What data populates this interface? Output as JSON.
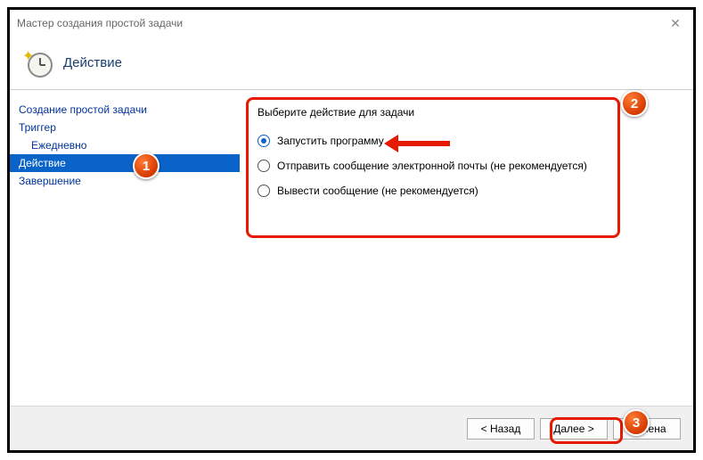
{
  "window": {
    "title": "Мастер создания простой задачи"
  },
  "header": {
    "title": "Действие"
  },
  "sidebar": {
    "items": [
      {
        "label": "Создание простой задачи"
      },
      {
        "label": "Триггер"
      },
      {
        "label": "Ежедневно"
      },
      {
        "label": "Действие"
      },
      {
        "label": "Завершение"
      }
    ]
  },
  "content": {
    "prompt": "Выберите действие для задачи",
    "options": [
      {
        "label": "Запустить программу",
        "checked": true
      },
      {
        "label": "Отправить сообщение электронной почты (не рекомендуется)",
        "checked": false
      },
      {
        "label": "Вывести сообщение (не рекомендуется)",
        "checked": false
      }
    ]
  },
  "footer": {
    "back": "< Назад",
    "next": "Далее >",
    "cancel": "Отмена"
  },
  "annotations": {
    "badges": [
      "1",
      "2",
      "3"
    ]
  }
}
